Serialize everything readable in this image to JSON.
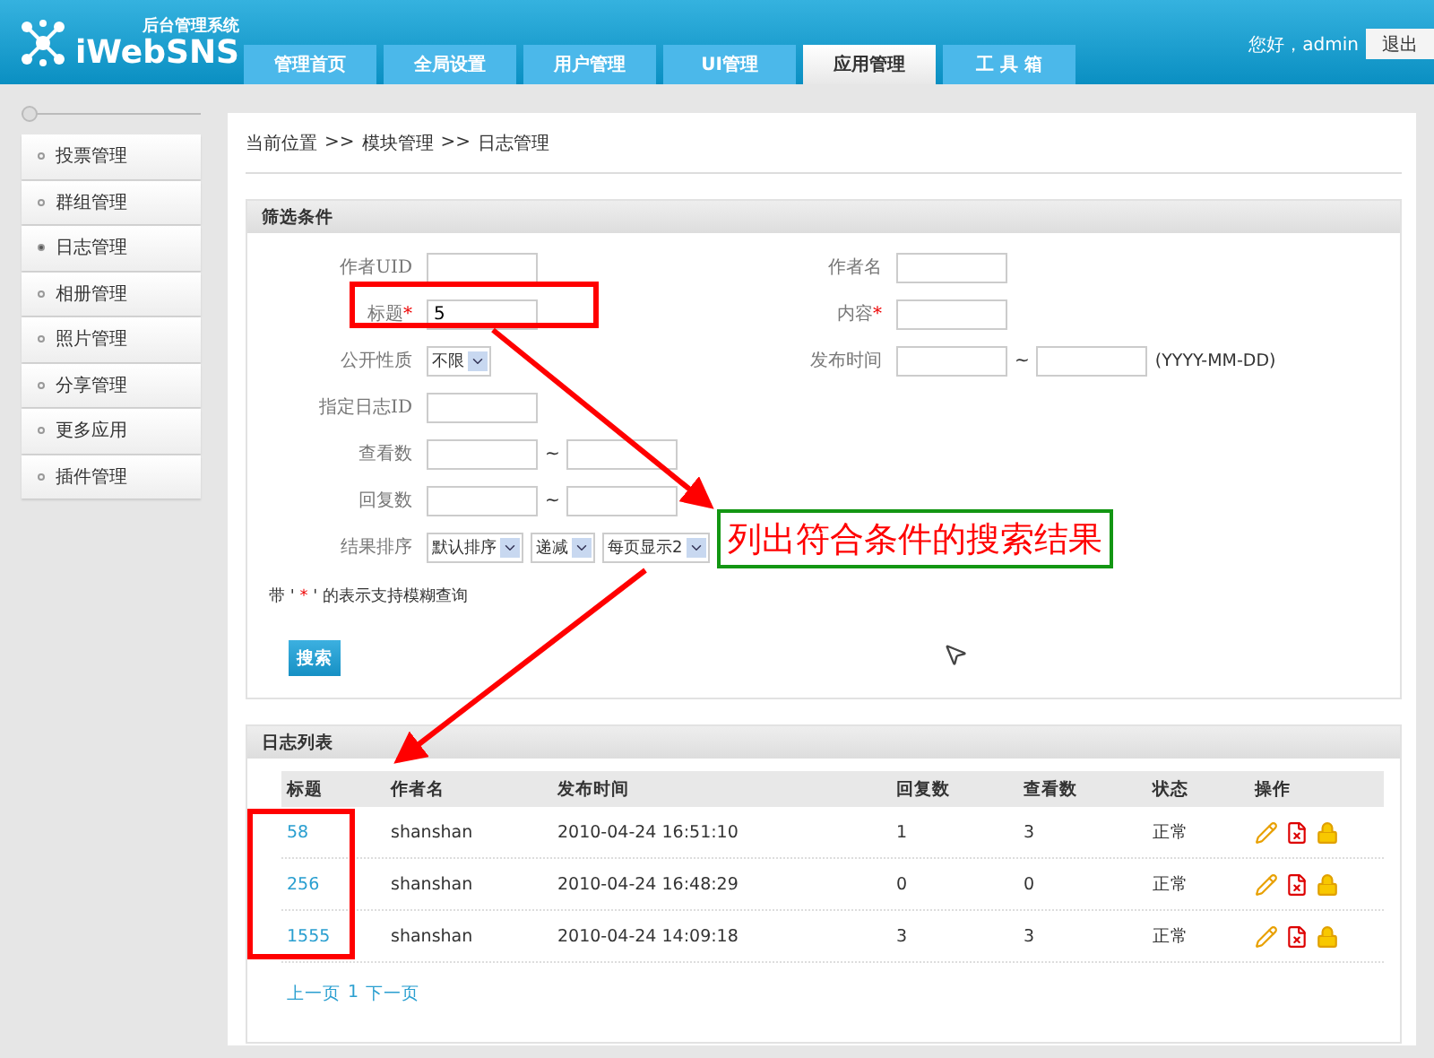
{
  "header": {
    "logo_subtitle": "后台管理系统",
    "logo_title": "iWebSNS",
    "greeting": "您好，admin",
    "logout": "退出"
  },
  "tabs": [
    {
      "label": "管理首页",
      "selected": false
    },
    {
      "label": "全局设置",
      "selected": false
    },
    {
      "label": "用户管理",
      "selected": false
    },
    {
      "label": "UI管理",
      "selected": false
    },
    {
      "label": "应用管理",
      "selected": true
    },
    {
      "label": "工 具 箱",
      "selected": false
    }
  ],
  "sidebar": {
    "items": [
      {
        "label": "投票管理",
        "selected": false
      },
      {
        "label": "群组管理",
        "selected": false
      },
      {
        "label": "日志管理",
        "selected": true
      },
      {
        "label": "相册管理",
        "selected": false
      },
      {
        "label": "照片管理",
        "selected": false
      },
      {
        "label": "分享管理",
        "selected": false
      },
      {
        "label": "更多应用",
        "selected": false
      },
      {
        "label": "插件管理",
        "selected": false
      }
    ]
  },
  "breadcrumb": [
    "当前位置",
    ">>",
    "模块管理",
    ">>",
    "日志管理"
  ],
  "filter": {
    "title": "筛选条件",
    "rows": [
      {
        "left": {
          "label": "作者UID",
          "kind": "text"
        },
        "right": {
          "label": "作者名",
          "kind": "text"
        }
      },
      {
        "left": {
          "label": "标题",
          "mark": "*",
          "kind": "text",
          "value": "5"
        },
        "right": {
          "label": "内容",
          "mark": "*",
          "kind": "text"
        }
      },
      {
        "left": {
          "label": "公开性质",
          "kind": "select",
          "values": [
            "不限"
          ]
        },
        "right": {
          "label": "发布时间",
          "kind": "range",
          "separator": "~",
          "hint": "(YYYY-MM-DD)"
        }
      },
      {
        "left": {
          "label": "指定日志ID",
          "kind": "text"
        }
      },
      {
        "left": {
          "label": "查看数",
          "kind": "range",
          "separator": "~"
        }
      },
      {
        "left": {
          "label": "回复数",
          "kind": "range",
          "separator": "~"
        }
      },
      {
        "left": {
          "label": "结果排序",
          "kind": "select",
          "values": [
            "默认排序",
            "递减",
            "每页显示2"
          ]
        }
      }
    ],
    "note": {
      "before": "带 ' ",
      "star": "*",
      "after": " ' 的表示支持模糊查询"
    },
    "search_button": "搜索"
  },
  "list": {
    "title": "日志列表",
    "columns": [
      "标题",
      "作者名",
      "发布时间",
      "回复数",
      "查看数",
      "状态",
      "操作"
    ],
    "rows": [
      {
        "title": "58",
        "author": "shanshan",
        "time": "2010-04-24 16:51:10",
        "replies": "1",
        "views": "3",
        "status": "正常"
      },
      {
        "title": "256",
        "author": "shanshan",
        "time": "2010-04-24 16:48:29",
        "replies": "0",
        "views": "0",
        "status": "正常"
      },
      {
        "title": "1555",
        "author": "shanshan",
        "time": "2010-04-24 14:09:18",
        "replies": "3",
        "views": "3",
        "status": "正常"
      }
    ],
    "pager": [
      "上一页",
      "1",
      "下一页"
    ]
  },
  "annotation": {
    "callout": "列出符合条件的搜索结果"
  }
}
